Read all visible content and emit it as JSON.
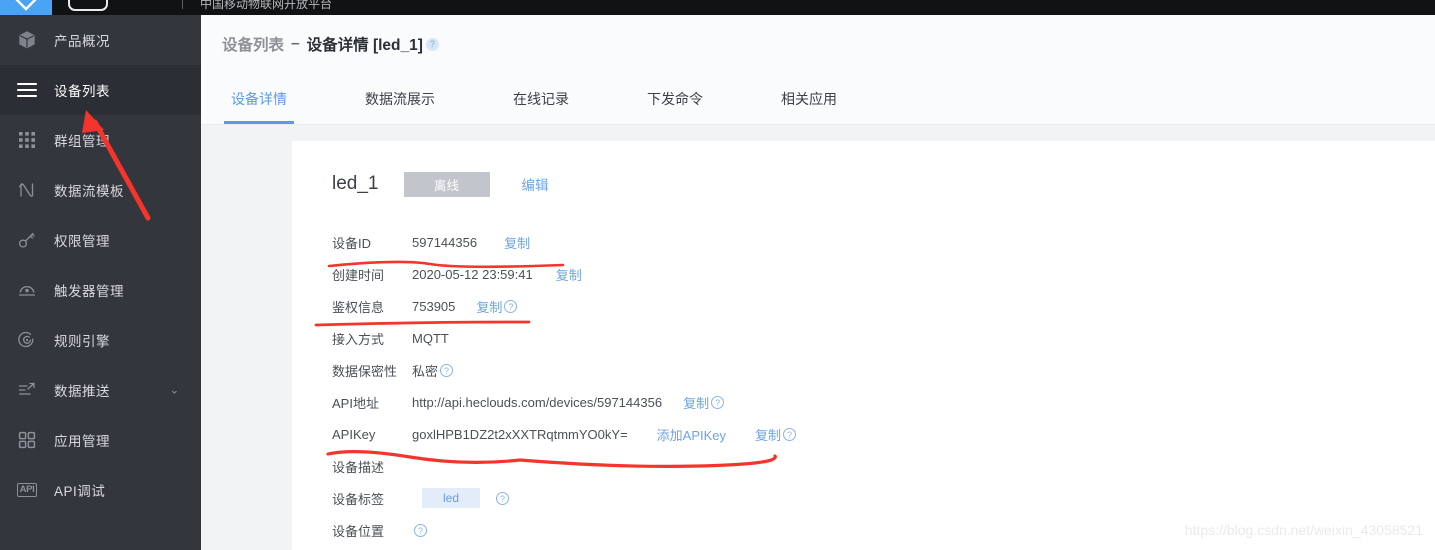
{
  "topbar": {
    "logo_icon": "chevron-down-logo-icon",
    "pill_icon": "rounded-pill-icon",
    "ghost_text": "中国移动物联网开放平台",
    "right_ghost_text": ""
  },
  "sidebar": {
    "items": [
      {
        "label": "产品概况",
        "icon": "cube-icon",
        "active": false,
        "caret": false
      },
      {
        "label": "设备列表",
        "icon": "list-lines-icon",
        "active": true,
        "caret": false
      },
      {
        "label": "群组管理",
        "icon": "grid-dots-icon",
        "active": false,
        "caret": false
      },
      {
        "label": "数据流模板",
        "icon": "curve-n-icon",
        "active": false,
        "caret": false
      },
      {
        "label": "权限管理",
        "icon": "key-icon",
        "active": false,
        "caret": false
      },
      {
        "label": "触发器管理",
        "icon": "trigger-icon",
        "active": false,
        "caret": false
      },
      {
        "label": "规则引擎",
        "icon": "rule-engine-icon",
        "active": false,
        "caret": false
      },
      {
        "label": "数据推送",
        "icon": "data-push-icon",
        "active": false,
        "caret": true
      },
      {
        "label": "应用管理",
        "icon": "apps-squares-icon",
        "active": false,
        "caret": false
      },
      {
        "label": "API调试",
        "icon": "api-icon",
        "active": false,
        "caret": false
      }
    ],
    "caret_glyph": "⌄"
  },
  "breadcrumb": {
    "parent": "设备列表",
    "separator": "–",
    "current": "设备详情 [led_1]",
    "help_glyph": "?"
  },
  "tabs": [
    {
      "label": "设备详情",
      "active": true
    },
    {
      "label": "数据流展示",
      "active": false
    },
    {
      "label": "在线记录",
      "active": false
    },
    {
      "label": "下发命令",
      "active": false
    },
    {
      "label": "相关应用",
      "active": false
    }
  ],
  "device": {
    "name": "led_1",
    "status": "离线",
    "edit_label": "编辑",
    "rows": [
      {
        "label": "设备ID",
        "value": "597144356",
        "copy": "复制",
        "help": false
      },
      {
        "label": "创建时间",
        "value": "2020-05-12 23:59:41",
        "copy": "复制",
        "help": false
      },
      {
        "label": "鉴权信息",
        "value": "753905",
        "copy": "复制",
        "help": true
      },
      {
        "label": "接入方式",
        "value": "MQTT",
        "copy": "",
        "help": false
      },
      {
        "label": "数据保密性",
        "value": "私密",
        "copy": "",
        "help": true
      },
      {
        "label": "API地址",
        "value": "http://api.heclouds.com/devices/597144356",
        "copy": "复制",
        "help": true
      },
      {
        "label": "APIKey",
        "value": "goxlHPB1DZ2t2xXXTRqtmmYO0kY=",
        "copy": "复制",
        "help": true,
        "extra_link": "添加APIKey"
      },
      {
        "label": "设备描述",
        "value": "",
        "copy": "",
        "help": false
      },
      {
        "label": "设备标签",
        "value": "",
        "copy": "",
        "help": true,
        "tag": "led"
      },
      {
        "label": "设备位置",
        "value": "",
        "copy": "",
        "help": true
      }
    ]
  },
  "annotation": {
    "color": "#f5352b",
    "arrow_label": "pointer-arrow-to-device-list",
    "underlines": [
      "device-id-underline",
      "auth-info-underline",
      "apikey-underline"
    ]
  },
  "watermark": "https://blog.csdn.net/weixin_43058521"
}
